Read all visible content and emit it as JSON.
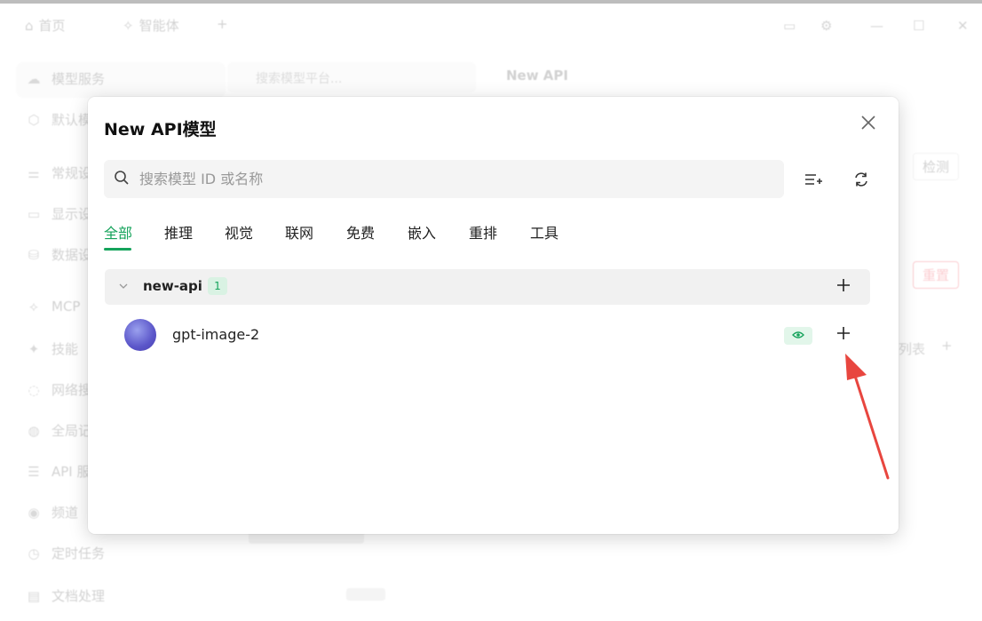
{
  "background": {
    "tabs": [
      {
        "icon": "home-icon",
        "glyph": "⌂",
        "label": "首页"
      },
      {
        "icon": "agent-icon",
        "glyph": "✧",
        "label": "智能体"
      }
    ],
    "new_tab_glyph": "+",
    "sidebar": [
      {
        "icon": "cloud-icon",
        "glyph": "☁",
        "label": "模型服务"
      },
      {
        "icon": "cube-icon",
        "glyph": "⬡",
        "label": "默认模"
      },
      {
        "icon": "sliders-icon",
        "glyph": "⚌",
        "label": "常规设"
      },
      {
        "icon": "display-icon",
        "glyph": "▭",
        "label": "显示设"
      },
      {
        "icon": "database-icon",
        "glyph": "⛁",
        "label": "数据设"
      },
      {
        "icon": "mcp-icon",
        "glyph": "⟡",
        "label": "MCP"
      },
      {
        "icon": "skill-icon",
        "glyph": "✦",
        "label": "技能"
      },
      {
        "icon": "web-search-icon",
        "glyph": "◌",
        "label": "网络搜"
      },
      {
        "icon": "global-icon",
        "glyph": "◍",
        "label": "全局记"
      },
      {
        "icon": "api-icon",
        "glyph": "☰",
        "label": "API 服"
      },
      {
        "icon": "channel-icon",
        "glyph": "◉",
        "label": "频道"
      },
      {
        "icon": "schedule-icon",
        "glyph": "◷",
        "label": "定时任务"
      },
      {
        "icon": "document-icon",
        "glyph": "▤",
        "label": "文档处理"
      }
    ],
    "search_placeholder": "搜索模型平台...",
    "provider_title": "New API",
    "check_button": "检测",
    "reset_button": "重置",
    "list_label": "列表"
  },
  "modal": {
    "title": "New API模型",
    "search_placeholder": "搜索模型 ID 或名称",
    "tabs": [
      "全部",
      "推理",
      "视觉",
      "联网",
      "免费",
      "嵌入",
      "重排",
      "工具"
    ],
    "active_tab": "全部",
    "group": {
      "name": "new-api",
      "count": "1"
    },
    "models": [
      {
        "name": "gpt-image-2",
        "capability_icon": "eye-icon"
      }
    ]
  },
  "colors": {
    "accent": "#15a35b",
    "arrow": "#e8463f"
  }
}
